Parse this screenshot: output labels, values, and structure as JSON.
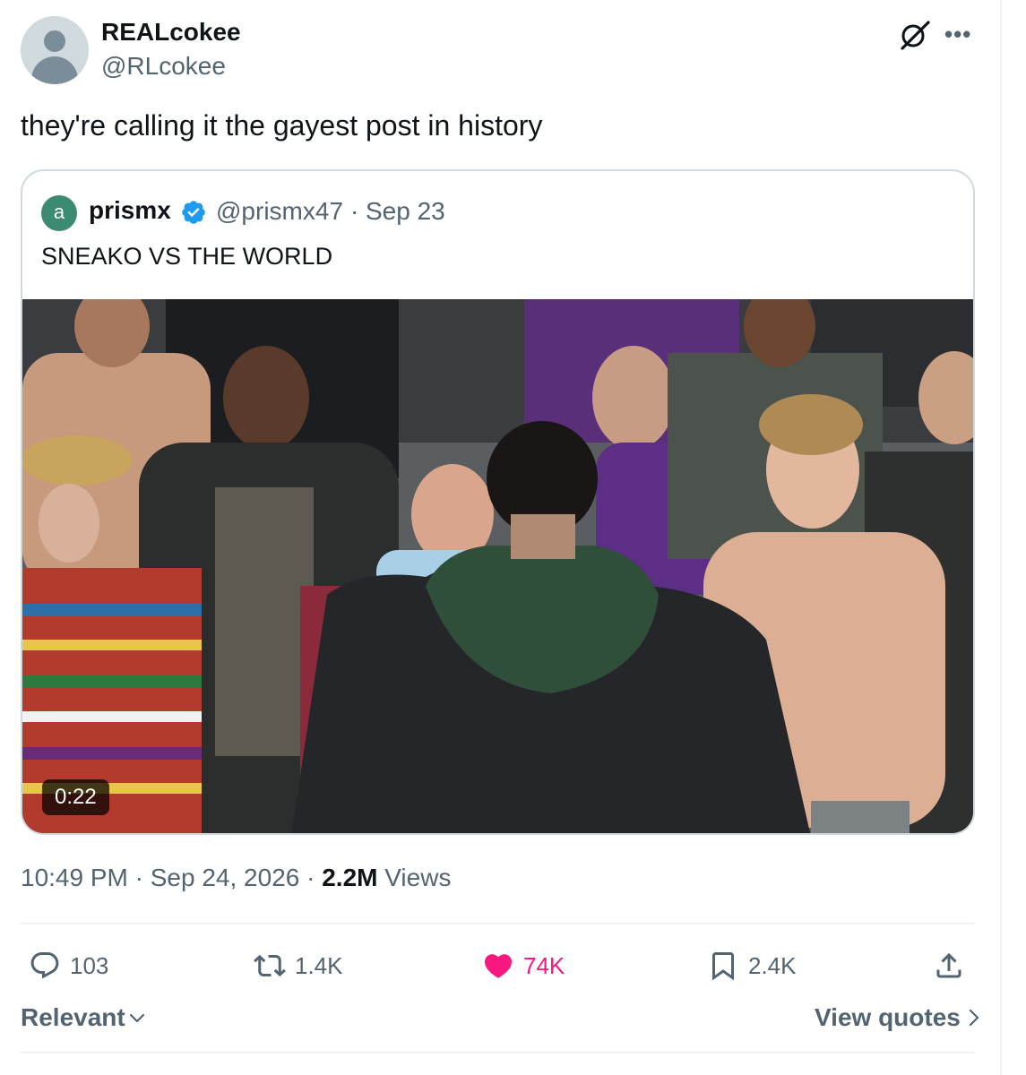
{
  "author": {
    "display_name": "REALcokee",
    "handle": "@RLcokee",
    "avatar_icon": "default-avatar-icon"
  },
  "tweet": {
    "text": "they're calling it the gayest post in history"
  },
  "quoted_tweet": {
    "avatar_letter": "a",
    "avatar_color": "#3b8a72",
    "display_name": "prismx",
    "verified": true,
    "handle": "@prismx47",
    "separator": "·",
    "date": "Sep 23",
    "text": "SNEAKO VS THE WORLD",
    "video_duration": "0:22"
  },
  "meta": {
    "time": "10:49 PM",
    "dot1": "·",
    "date": "Sep 24, 2026",
    "dot2": "·",
    "views_count": "2.2M",
    "views_label": "Views"
  },
  "actions": {
    "replies": "103",
    "reposts": "1.4K",
    "likes": "74K",
    "bookmarks": "2.4K"
  },
  "footer": {
    "sort_label": "Relevant",
    "view_quotes_label": "View quotes"
  },
  "colors": {
    "primary_text": "#0f1419",
    "secondary_text": "#536471",
    "like_pink": "#f91880",
    "verified_blue": "#1d9bf0",
    "border": "#cfd9de"
  }
}
